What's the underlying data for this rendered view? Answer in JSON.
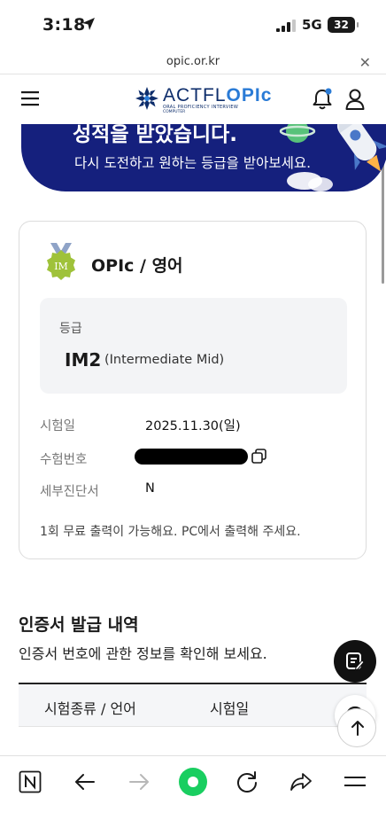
{
  "status_bar": {
    "time": "3:18",
    "network": "5G",
    "battery": "32"
  },
  "browser": {
    "url": "opic.or.kr",
    "close_icon": "close-icon"
  },
  "header": {
    "logo_text_a": "ACTFL",
    "logo_text_b": "OPIc",
    "logo_sub1": "ORAL PROFICIENCY INTERVIEW",
    "logo_sub2": "COMPUTER"
  },
  "banner": {
    "title": "성적을 받았습니다.",
    "subtitle": "다시 도전하고 원하는 등급을 받아보세요."
  },
  "result": {
    "medal_text": "IM",
    "test_name": "OPIc / 영어",
    "grade_label": "등급",
    "grade": "IM2",
    "grade_desc": "(Intermediate Mid)",
    "rows": [
      {
        "label": "시험일",
        "value": "2025.11.30(일)"
      },
      {
        "label": "수험번호",
        "value": ""
      },
      {
        "label": "세부진단서",
        "value": "N"
      }
    ],
    "note": "1회 무료 출력이 가능해요. PC에서 출력해 주세요."
  },
  "history": {
    "title": "인증서 발급 내역",
    "desc": "인증서 번호에 관한 정보를 확인해 보세요.",
    "columns": [
      "시험종류 / 언어",
      "시험일"
    ]
  },
  "colors": {
    "banner": "#15207d",
    "brand_navy": "#0d2d6b",
    "brand_blue": "#2a7bd6",
    "medal": "#9fc23a"
  }
}
